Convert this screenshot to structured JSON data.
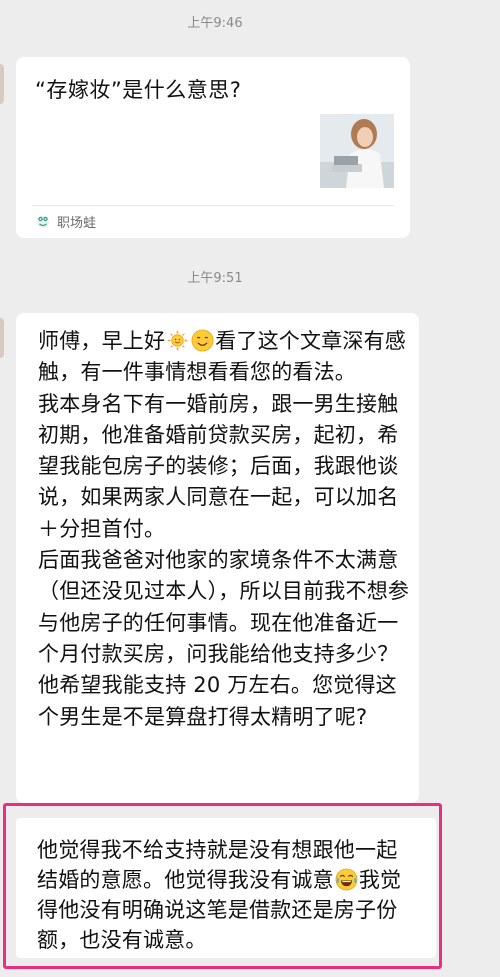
{
  "messages": {
    "time1": "上午9:46",
    "time2": "上午9:51"
  },
  "link_card": {
    "title": "“存嫁妆”是什么意思?",
    "source": "职场蛙",
    "source_icon": "frog-logo-icon"
  },
  "bubble1": {
    "line1_a": "师傅，早上好",
    "line1_b": "看了这个文章",
    "rest": "深有感触，有一件事情想看看您的看法。\n我本身名下有一婚前房，跟一男生接触初期，他准备婚前贷款买房，起初，希望我能包房子的装修；后面，我跟他谈说，如果两家人同意在一起，可以加名＋分担首付。\n后面我爸爸对他家的家境条件不太满意（但还没见过本人），所以目前我不想参与他房子的任何事情。现在他准备近一个月付款买房，问我能给他支持多少？他希望我能支持 20 万左右。您觉得这个男生是不是算盘打得太精明了呢?",
    "emoji1": "sun-emoji",
    "emoji2": "smile-emoji"
  },
  "bubble2": {
    "part1": "他觉得我不给支持就是没有想跟他一起结婚的意愿。他觉得我没有诚意",
    "part2": "我觉得他没有明确说这笔是借款还是房子份额，也没有诚意。",
    "emoji": "laugh-cry-emoji"
  },
  "colors": {
    "background": "#ededed",
    "bubble": "#ffffff",
    "highlight": "#e8307e"
  }
}
